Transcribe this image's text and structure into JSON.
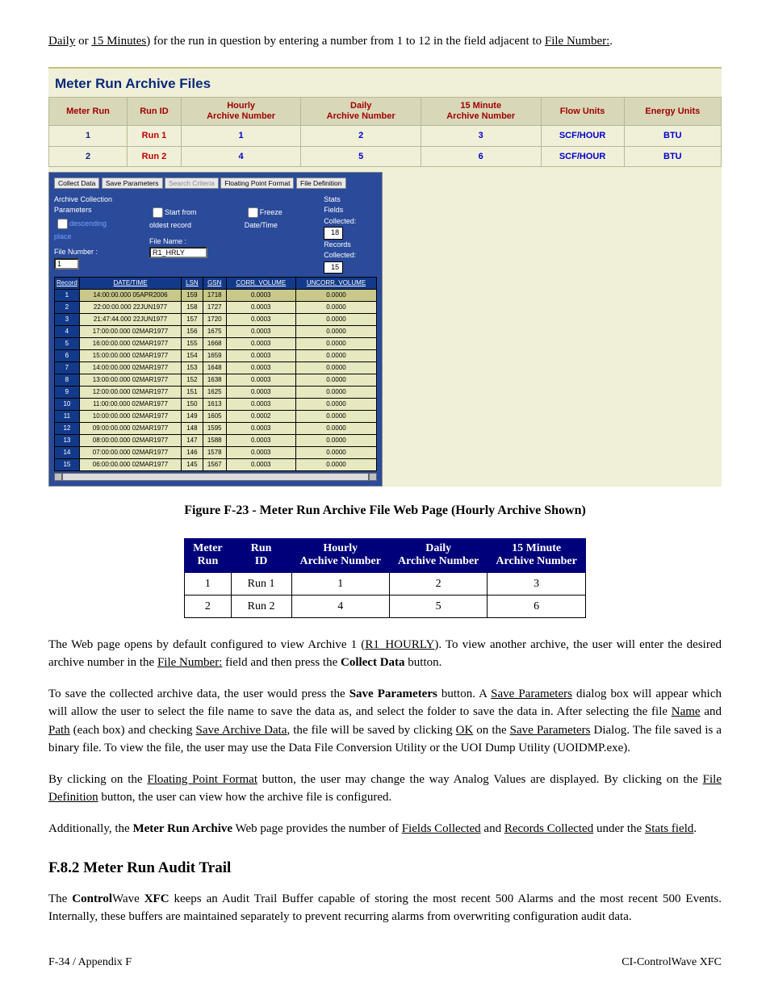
{
  "intro": {
    "p1_pre": "Daily",
    "p1_mid": " or ",
    "p1_u2": "15 Minutes",
    "p1_post": ") for the run in question by entering a number from 1 to 12 in the field adjacent to ",
    "p1_u3": "File Number:",
    "p1_end": "."
  },
  "screenshot": {
    "title": "Meter Run Archive Files",
    "headers": {
      "meter_run": "Meter Run",
      "run_id": "Run ID",
      "hourly": "Hourly\nArchive Number",
      "daily": "Daily\nArchive Number",
      "fifteen": "15 Minute\nArchive Number",
      "flow_units": "Flow Units",
      "energy_units": "Energy Units"
    },
    "rows": [
      {
        "mr": "1",
        "rid": "Run 1",
        "h": "1",
        "d": "2",
        "f": "3",
        "fu": "SCF/HOUR",
        "eu": "BTU"
      },
      {
        "mr": "2",
        "rid": "Run 2",
        "h": "4",
        "d": "5",
        "f": "6",
        "fu": "SCF/HOUR",
        "eu": "BTU"
      }
    ],
    "buttons": {
      "collect": "Collect Data",
      "save": "Save Parameters",
      "search": "Search Criteria",
      "float": "Floating Point Format",
      "filedef": "File Definition"
    },
    "params": {
      "section_label": "Archive Collection Parameters",
      "descending": "descending place",
      "start_oldest": "Start from oldest record",
      "freeze": "Freeze Date/Time",
      "file_number_label": "File Number :",
      "file_number_val": "1",
      "file_name_label": "File Name :",
      "file_name_val": "R1_HRLY"
    },
    "stats": {
      "label": "Stats",
      "fields_label": "Fields Collected:",
      "fields_val": "18",
      "records_label": "Records Collected:",
      "records_val": "15"
    },
    "rec_headers": [
      "Record",
      "DATE/TIME",
      "LSN",
      "GSN",
      "CORR. VOLUME",
      "UNCORR. VOLUME"
    ],
    "records": [
      {
        "i": "1",
        "dt": "14:00:00.000 05APR2006",
        "lsn": "159",
        "gsn": "1718",
        "cv": "0.0003",
        "uv": "0.0000",
        "sel": true
      },
      {
        "i": "2",
        "dt": "22:00:00.000 22JUN1977",
        "lsn": "158",
        "gsn": "1727",
        "cv": "0.0003",
        "uv": "0.0000"
      },
      {
        "i": "3",
        "dt": "21:47:44.000 22JUN1977",
        "lsn": "157",
        "gsn": "1720",
        "cv": "0.0003",
        "uv": "0.0000"
      },
      {
        "i": "4",
        "dt": "17:00:00.000 02MAR1977",
        "lsn": "156",
        "gsn": "1675",
        "cv": "0.0003",
        "uv": "0.0000"
      },
      {
        "i": "5",
        "dt": "16:00:00.000 02MAR1977",
        "lsn": "155",
        "gsn": "1668",
        "cv": "0.0003",
        "uv": "0.0000"
      },
      {
        "i": "6",
        "dt": "15:00:00.000 02MAR1977",
        "lsn": "154",
        "gsn": "1659",
        "cv": "0.0003",
        "uv": "0.0000"
      },
      {
        "i": "7",
        "dt": "14:00:00.000 02MAR1977",
        "lsn": "153",
        "gsn": "1648",
        "cv": "0.0003",
        "uv": "0.0000"
      },
      {
        "i": "8",
        "dt": "13:00:00.000 02MAR1977",
        "lsn": "152",
        "gsn": "1638",
        "cv": "0.0003",
        "uv": "0.0000"
      },
      {
        "i": "9",
        "dt": "12:00:00.000 02MAR1977",
        "lsn": "151",
        "gsn": "1625",
        "cv": "0.0003",
        "uv": "0.0000"
      },
      {
        "i": "10",
        "dt": "11:00:00.000 02MAR1977",
        "lsn": "150",
        "gsn": "1613",
        "cv": "0.0003",
        "uv": "0.0000"
      },
      {
        "i": "11",
        "dt": "10:00:00.000 02MAR1977",
        "lsn": "149",
        "gsn": "1605",
        "cv": "0.0002",
        "uv": "0.0000"
      },
      {
        "i": "12",
        "dt": "09:00:00.000 02MAR1977",
        "lsn": "148",
        "gsn": "1595",
        "cv": "0.0003",
        "uv": "0.0000"
      },
      {
        "i": "13",
        "dt": "08:00:00.000 02MAR1977",
        "lsn": "147",
        "gsn": "1588",
        "cv": "0.0003",
        "uv": "0.0000"
      },
      {
        "i": "14",
        "dt": "07:00:00.000 02MAR1977",
        "lsn": "146",
        "gsn": "1578",
        "cv": "0.0003",
        "uv": "0.0000"
      },
      {
        "i": "15",
        "dt": "06:00:00.000 02MAR1977",
        "lsn": "145",
        "gsn": "1567",
        "cv": "0.0003",
        "uv": "0.0000"
      }
    ]
  },
  "figure_caption": "Figure F-23 - Meter Run Archive File Web Page (Hourly Archive Shown)",
  "summary": {
    "headers": [
      "Meter Run",
      "Run ID",
      "Hourly Archive Number",
      "Daily Archive Number",
      "15 Minute Archive Number"
    ],
    "rows": [
      [
        "1",
        "Run 1",
        "1",
        "2",
        "3"
      ],
      [
        "2",
        "Run 2",
        "4",
        "5",
        "6"
      ]
    ]
  },
  "body": {
    "p1_a": "The Web page opens by default configured to view Archive 1 (",
    "p1_u": "R1_HOURLY",
    "p1_b": "). To view another archive, the user will enter the desired archive number in the ",
    "p1_u2": "File Number:",
    "p1_c": " field and then press the ",
    "p1_bold": "Collect Data",
    "p1_d": " button.",
    "p2_a": "To save the collected archive data, the user would press the ",
    "p2_bold1": "Save Parameters",
    "p2_b": " button. A ",
    "p2_u1": "Save Parameters",
    "p2_c": " dialog box will appear which will allow the user to select the file name to save the data as, and select the folder to save the data in. After selecting the file ",
    "p2_u2": "Name",
    "p2_d": " and ",
    "p2_u3": "Path",
    "p2_e": " (each box) and checking ",
    "p2_u4": "Save Archive Data",
    "p2_f": ", the file will be saved by clicking ",
    "p2_u5": "OK",
    "p2_g": " on the ",
    "p2_u6": "Save Parameters",
    "p2_h": " Dialog.  The file saved is a binary file. To view the file, the user may use the Data File Conversion Utility or the UOI Dump Utility (UOIDMP.exe).",
    "p3_a": "By clicking on the ",
    "p3_u1": "Floating Point Format",
    "p3_b": " button, the user may change the way Analog Values are displayed. By clicking on the ",
    "p3_u2": "File Definition",
    "p3_c": " button, the user can view how the archive file is configured.",
    "p4_a": "Additionally, the ",
    "p4_bold": "Meter Run Archive",
    "p4_b": " Web page provides the number of ",
    "p4_u1": "Fields Collected",
    "p4_c": " and ",
    "p4_u2": "Records Collected",
    "p4_d": " under the ",
    "p4_u3": "Stats field",
    "p4_e": "."
  },
  "section": {
    "heading": "F.8.2  Meter Run Audit Trail",
    "p1_a": "The ",
    "p1_b1": "Control",
    "p1_m": "Wave ",
    "p1_b2": "XFC",
    "p1_b": " keeps an Audit Trail Buffer capable of storing the most recent 500 Alarms and the most recent 500 Events. Internally, these buffers are maintained separately to prevent recurring alarms from overwriting configuration audit data."
  },
  "footer": {
    "left": "F-34 / Appendix F",
    "right": "CI-ControlWave XFC"
  }
}
